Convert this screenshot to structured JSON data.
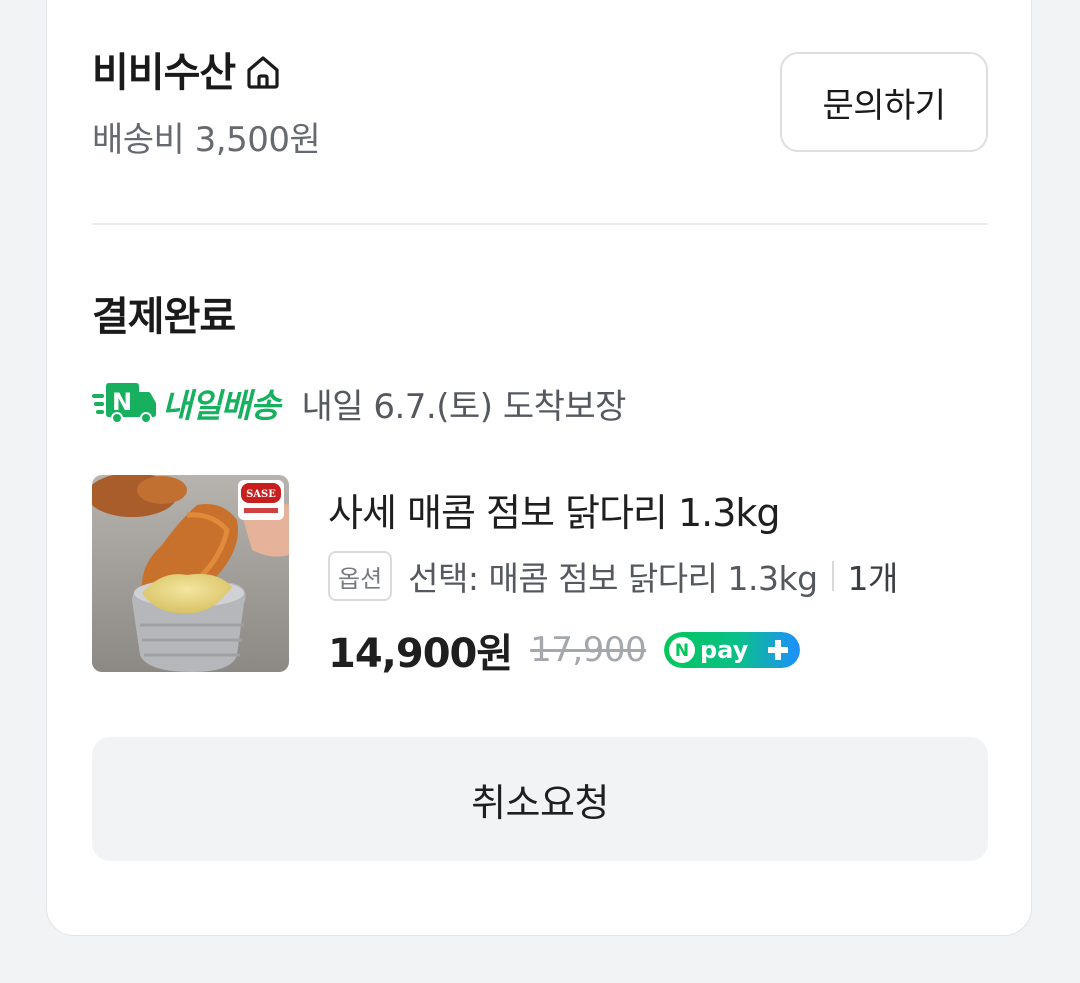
{
  "store": {
    "name": "비비수산",
    "shipping_fee": "배송비 3,500원",
    "inquiry_label": "문의하기"
  },
  "order": {
    "status": "결제완료",
    "delivery_badge": "내일배송",
    "delivery_badge_icon_letter": "N",
    "delivery_text": "내일 6.7.(토) 도착보장"
  },
  "product": {
    "name": "사세 매콤 점보 닭다리 1.3kg",
    "option_tag": "옵션",
    "option_text": "선택: 매콤 점보 닭다리 1.3kg",
    "quantity": "1개",
    "price": "14,900원",
    "original_price": "17,900",
    "pay_badge": "pay",
    "thumbnail_logo": "SASE"
  },
  "actions": {
    "cancel_label": "취소요청"
  },
  "colors": {
    "accent_green": "#16b05f",
    "npay_gradient_start": "#03c75a",
    "npay_gradient_end": "#1e8fff"
  }
}
